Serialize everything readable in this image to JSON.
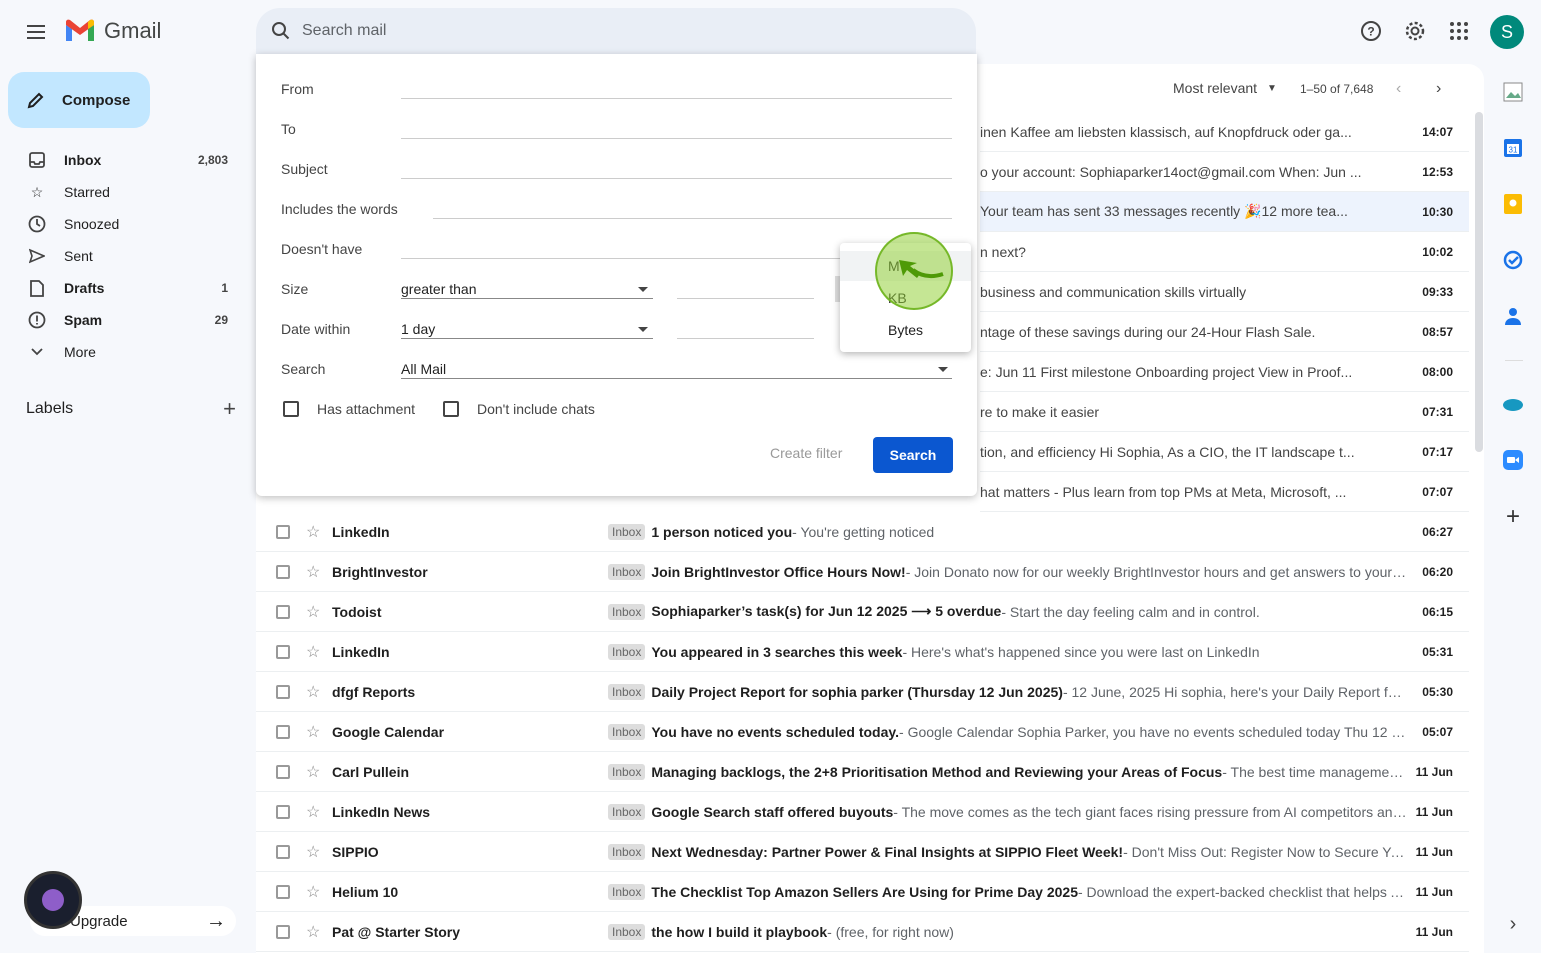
{
  "app": {
    "name": "Gmail"
  },
  "search": {
    "placeholder": "Search mail"
  },
  "sidebar": {
    "compose_label": "Compose",
    "items": [
      {
        "label": "Inbox",
        "count": "2,803"
      },
      {
        "label": "Starred",
        "count": ""
      },
      {
        "label": "Snoozed",
        "count": ""
      },
      {
        "label": "Sent",
        "count": ""
      },
      {
        "label": "Drafts",
        "count": "1"
      },
      {
        "label": "Spam",
        "count": "29"
      },
      {
        "label": "More",
        "count": ""
      }
    ],
    "labels_heading": "Labels",
    "upgrade_label": "Upgrade"
  },
  "toolbar": {
    "sort_label": "Most relevant",
    "range": "1–50 of 7,648"
  },
  "filter": {
    "from_label": "From",
    "to_label": "To",
    "subject_label": "Subject",
    "includes_label": "Includes the words",
    "doesnt_have_label": "Doesn't have",
    "size_label": "Size",
    "size_op": "greater than",
    "date_label": "Date within",
    "date_value": "1 day",
    "search_label": "Search",
    "search_value": "All Mail",
    "has_attachment": "Has attachment",
    "no_chats": "Don't include chats",
    "create_filter": "Create filter",
    "search_button": "Search",
    "units": [
      "M",
      "KB",
      "Bytes"
    ]
  },
  "truncated_rows": [
    {
      "snippet": "inen Kaffee am liebsten klassisch, auf Knopfdruck oder ga...",
      "time": "14:07"
    },
    {
      "snippet": "o your account: Sophiaparker14oct@gmail.com When: Jun ...",
      "time": "12:53"
    },
    {
      "snippet": "Your team has sent 33 messages recently 🎉12 more tea...",
      "time": "10:30"
    },
    {
      "snippet": "n next?",
      "time": "10:02"
    },
    {
      "snippet": "business and communication skills virtually",
      "time": "09:33"
    },
    {
      "snippet": "ntage of these savings during our 24-Hour Flash Sale.",
      "time": "08:57"
    },
    {
      "snippet": "e: Jun 11 First milestone Onboarding project View in Proof...",
      "time": "08:00"
    },
    {
      "snippet": "re to make it easier",
      "time": "07:31"
    },
    {
      "snippet": "tion, and efficiency Hi Sophia, As a CIO, the IT landscape t...",
      "time": "07:17"
    },
    {
      "snippet": "hat matters - Plus learn from top PMs at Meta, Microsoft, ...",
      "time": "07:07"
    }
  ],
  "emails": [
    {
      "sender": "LinkedIn",
      "badge": "Inbox",
      "subject": "1 person noticed you",
      "snippet": " - You're getting noticed",
      "time": "06:27"
    },
    {
      "sender": "BrightInvestor",
      "badge": "Inbox",
      "subject": "Join BrightInvestor Office Hours Now!",
      "snippet": " - Join Donato now for our weekly BrightInvestor hours and get answers to your q...",
      "time": "06:20"
    },
    {
      "sender": "Todoist",
      "badge": "Inbox",
      "subject": "Sophiaparker’s task(s) for Jun 12 2025 ⟶ 5 overdue",
      "snippet": " - Start the day feeling calm and in control.",
      "time": "06:15"
    },
    {
      "sender": "LinkedIn",
      "badge": "Inbox",
      "subject": "You appeared in 3 searches this week",
      "snippet": " - Here's what's happened since you were last on LinkedIn",
      "time": "05:31"
    },
    {
      "sender": "dfgf Reports",
      "badge": "Inbox",
      "subject": "Daily Project Report for sophia parker (Thursday 12 Jun 2025)",
      "snippet": " - 12 June, 2025 Hi sophia, here's your Daily Report for ...",
      "time": "05:30"
    },
    {
      "sender": "Google Calendar",
      "badge": "Inbox",
      "subject": "You have no events scheduled today.",
      "snippet": " - Google Calendar Sophia Parker, you have no events scheduled today Thu 12 Jun...",
      "time": "05:07"
    },
    {
      "sender": "Carl Pullein",
      "badge": "Inbox",
      "subject": "Managing backlogs, the 2+8 Prioritisation Method and Reviewing your Areas of Focus",
      "snippet": " - The best time management ...",
      "time": "11 Jun"
    },
    {
      "sender": "LinkedIn News",
      "badge": "Inbox",
      "subject": "Google Search staff offered buyouts",
      "snippet": " - The move comes as the tech giant faces rising pressure from AI competitors and...",
      "time": "11 Jun"
    },
    {
      "sender": "SIPPIO",
      "badge": "Inbox",
      "subject": "Next Wednesday: Partner Power & Final Insights at SIPPIO Fleet Week!",
      "snippet": " - Don't Miss Out: Register Now to Secure Your...",
      "time": "11 Jun"
    },
    {
      "sender": "Helium 10",
      "badge": "Inbox",
      "subject": "The Checklist Top Amazon Sellers Are Using for Prime Day 2025",
      "snippet": " - Download the expert-backed checklist that helps A...",
      "time": "11 Jun"
    },
    {
      "sender": "Pat @ Starter Story",
      "badge": "Inbox",
      "subject": "the how I build it playbook",
      "snippet": " - (free, for right now)",
      "time": "11 Jun"
    }
  ],
  "avatar_letter": "S",
  "colors": {
    "accent": "#0b57d0",
    "compose_bg": "#c2e7ff",
    "avatar": "#00897b"
  }
}
